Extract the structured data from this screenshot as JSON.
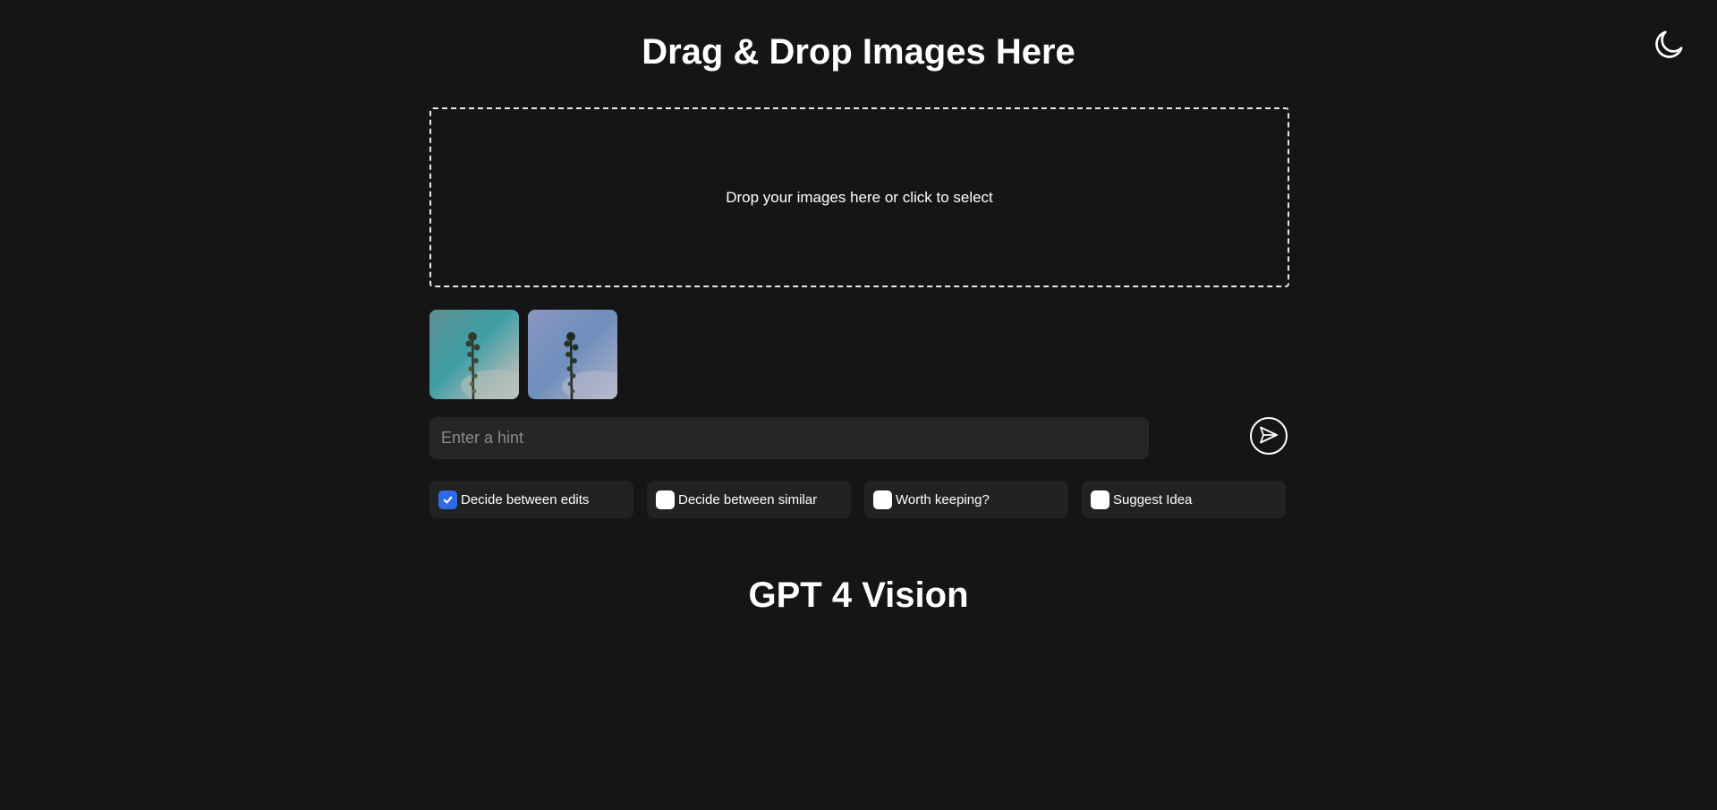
{
  "header": {
    "title": "Drag & Drop Images Here",
    "theme_toggle_icon": "moon-icon"
  },
  "dropzone": {
    "text": "Drop your images here or click to select"
  },
  "thumbnails": [
    {
      "name": "uploaded-image-1",
      "tint": "#4a8a8e"
    },
    {
      "name": "uploaded-image-2",
      "tint": "#7d8fb5"
    }
  ],
  "hint": {
    "placeholder": "Enter a hint",
    "value": ""
  },
  "send": {
    "icon": "send-icon"
  },
  "options": [
    {
      "label": "Decide between edits",
      "checked": true
    },
    {
      "label": "Decide between similar",
      "checked": false
    },
    {
      "label": "Worth keeping?",
      "checked": false
    },
    {
      "label": "Suggest Idea",
      "checked": false
    }
  ],
  "result": {
    "title": "GPT 4 Vision"
  },
  "colors": {
    "background": "#151515",
    "accent": "#2d6ae6",
    "input_bg": "#262626",
    "option_bg": "#222222"
  }
}
